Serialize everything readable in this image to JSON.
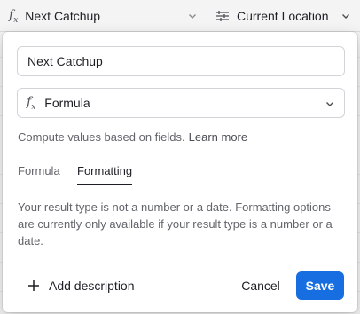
{
  "columns": {
    "first": {
      "icon": "formula-icon",
      "label": "Next Catchup"
    },
    "second": {
      "icon": "location-lines-icon",
      "label": "Current Location"
    }
  },
  "field_editor": {
    "name_value": "Next Catchup",
    "type_select": {
      "icon": "formula-icon",
      "label": "Formula"
    },
    "description": "Compute values based on fields.",
    "learn_more": "Learn more",
    "tabs": [
      {
        "label": "Formula",
        "active": false
      },
      {
        "label": "Formatting",
        "active": true
      }
    ],
    "info_text": "Your result type is not a number or a date. Formatting options are currently only available if your result type is a number or a date.",
    "add_description": "Add description",
    "cancel": "Cancel",
    "save": "Save"
  },
  "colors": {
    "accent": "#166ee1",
    "text": "#1d1f25",
    "muted": "#62656b"
  }
}
